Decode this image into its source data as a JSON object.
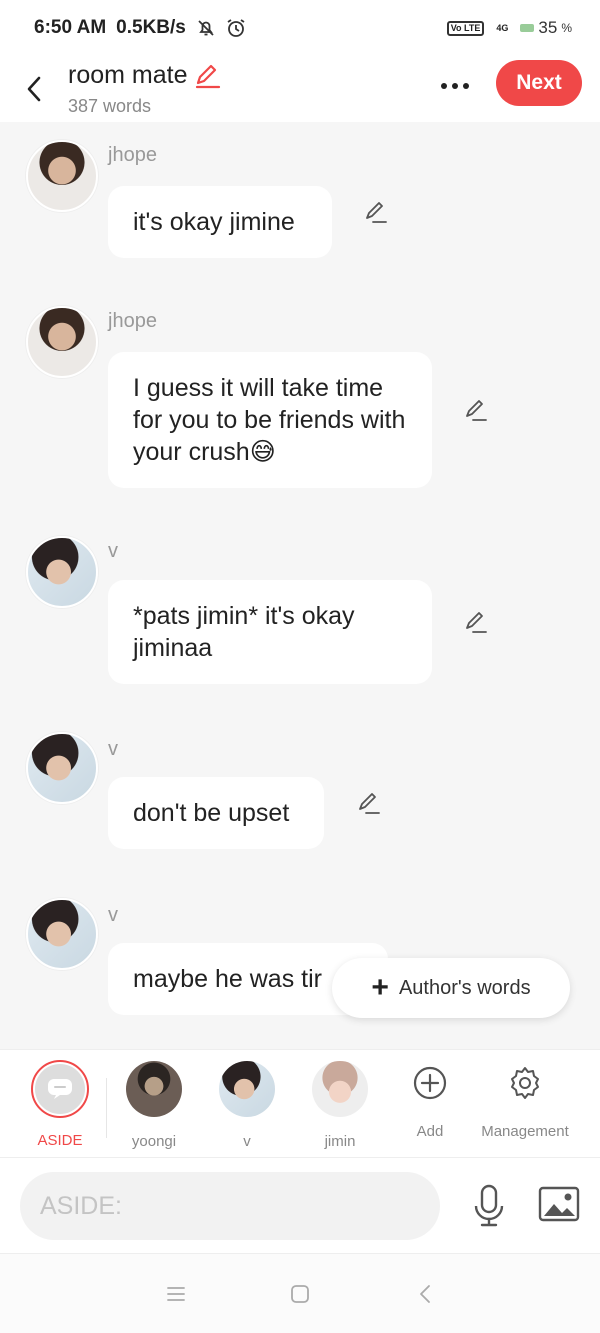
{
  "status_bar": {
    "time": "6:50 AM",
    "speed": "0.5KB/s",
    "volte": "Vo LTE",
    "network": "4G",
    "battery": "35",
    "battery_unit": "%"
  },
  "header": {
    "title": "room mate",
    "word_count": "387 words",
    "next_label": "Next",
    "accent_color": "#f04848"
  },
  "messages": [
    {
      "sender": "jhope",
      "text": "it's okay jimine"
    },
    {
      "sender": "jhope",
      "text": "I guess it will take time for you to be friends with your crush😅"
    },
    {
      "sender": "v",
      "text": "*pats jimin* it's okay jiminaa"
    },
    {
      "sender": "v",
      "text": "don't be upset"
    },
    {
      "sender": "v",
      "text": "maybe he was tir"
    }
  ],
  "author_words": {
    "plus": "+",
    "label": "Author's words"
  },
  "characters": [
    {
      "label": "ASIDE",
      "selected": true
    },
    {
      "label": "yoongi"
    },
    {
      "label": "v"
    },
    {
      "label": "jimin"
    },
    {
      "label": "Add",
      "icon": "plus-circle-icon"
    },
    {
      "label": "Management",
      "icon": "gear-icon"
    }
  ],
  "input": {
    "placeholder": "ASIDE:",
    "value": ""
  }
}
